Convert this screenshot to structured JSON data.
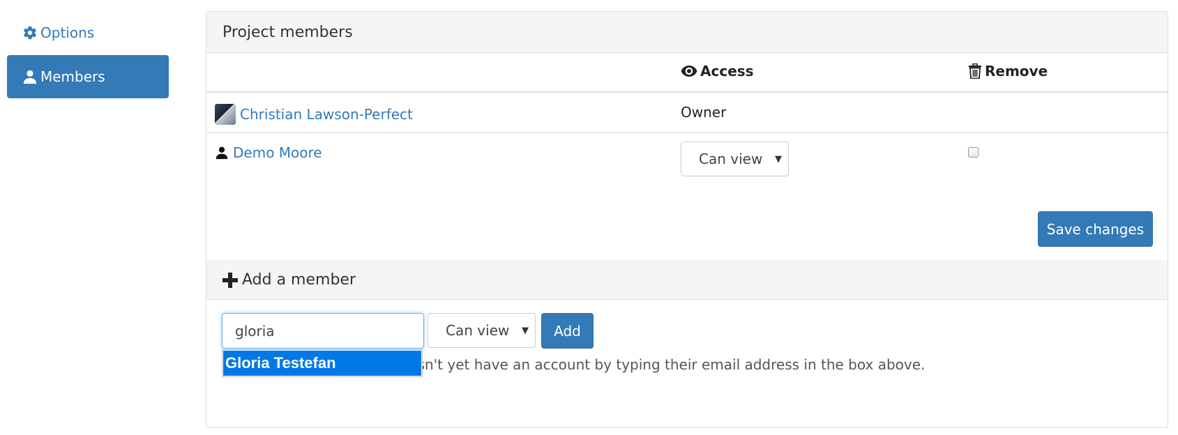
{
  "sidebar": {
    "items": [
      {
        "label": "Options",
        "icon": "gear-icon"
      },
      {
        "label": "Members",
        "icon": "person-icon",
        "active": true
      }
    ]
  },
  "panel": {
    "title": "Project members",
    "columns": {
      "access": "Access",
      "remove": "Remove"
    },
    "members": [
      {
        "name": "Christian Lawson-Perfect",
        "access": "Owner",
        "icon": "avatar"
      },
      {
        "name": "Demo Moore",
        "access_select": "Can view",
        "icon": "person-icon"
      }
    ],
    "save_label": "Save changes"
  },
  "add_member": {
    "title": "Add a member",
    "input_value": "gloria",
    "access_select": "Can view",
    "add_label": "Add",
    "help_text": "You can add a user who doesn't yet have an account by typing their email address in the box above.",
    "autocomplete": [
      "Gloria Testefan"
    ]
  },
  "colors": {
    "primary": "#337ab7",
    "autocomplete_highlight": "#0078e7"
  }
}
